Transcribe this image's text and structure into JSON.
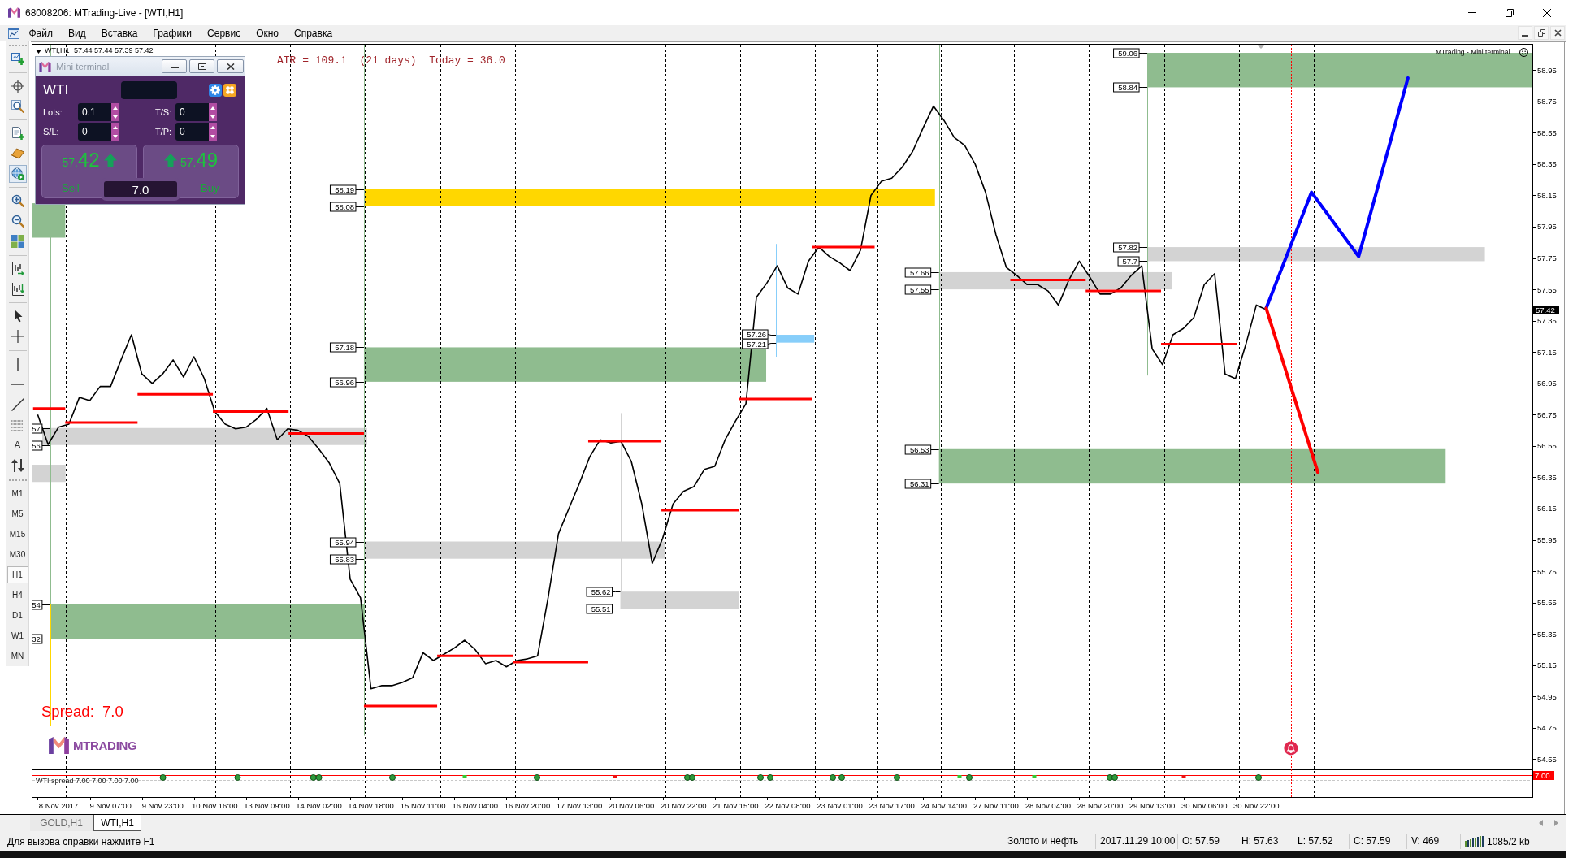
{
  "window": {
    "title": "68008206: MTrading-Live - [WTI,H1]"
  },
  "menu": [
    "Файл",
    "Вид",
    "Вставка",
    "Графики",
    "Сервис",
    "Окно",
    "Справка"
  ],
  "toolbar": {
    "text_tool": "A",
    "timeframes": [
      {
        "label": "M1",
        "selected": false
      },
      {
        "label": "M5",
        "selected": false
      },
      {
        "label": "M15",
        "selected": false
      },
      {
        "label": "M30",
        "selected": false
      },
      {
        "label": "H1",
        "selected": true
      },
      {
        "label": "H4",
        "selected": false
      },
      {
        "label": "D1",
        "selected": false
      },
      {
        "label": "W1",
        "selected": false
      },
      {
        "label": "MN",
        "selected": false
      }
    ]
  },
  "chart": {
    "ohlc": "57.44 57.44 57.39 57.42",
    "atr_text": "ATR = 109.1  (21 days)  Today = 36.0",
    "corner_label": "MTrading - Mini terminal",
    "spread_text": "Spread:  7.0",
    "logo_text": "MTRADING",
    "chart_data": {
      "type": "line",
      "ylim": [
        54.485,
        59.112
      ],
      "categories": [
        null,
        null,
        "8 Nov 2017",
        null,
        null,
        null,
        null,
        "9 Nov 07:00",
        null,
        null,
        null,
        null,
        "9 Nov 23:00",
        null,
        null,
        null,
        null,
        "10 Nov 16:00",
        null,
        null,
        null,
        null,
        "13 Nov 09:00",
        null,
        null,
        null,
        null,
        "14 Nov 02:00",
        null,
        null,
        null,
        null,
        "14 Nov 18:00",
        null,
        null,
        null,
        null,
        "15 Nov 11:00",
        null,
        null,
        null,
        null,
        "16 Nov 04:00",
        null,
        null,
        null,
        null,
        "16 Nov 20:00",
        null,
        null,
        null,
        null,
        "17 Nov 13:00",
        null,
        null,
        null,
        null,
        "20 Nov 06:00",
        null,
        null,
        null,
        null,
        "20 Nov 22:00",
        null,
        null,
        null,
        null,
        "21 Nov 15:00",
        null,
        null,
        null,
        null,
        "22 Nov 08:00",
        null,
        null,
        null,
        null,
        "23 Nov 01:00",
        null,
        null,
        null,
        null,
        "23 Nov 17:00",
        null,
        null,
        null,
        null,
        "24 Nov 14:00",
        null,
        null,
        null,
        null,
        "27 Nov 11:00",
        null,
        null,
        null,
        null,
        "28 Nov 04:00",
        null,
        null,
        null,
        null,
        "28 Nov 20:00",
        null,
        null,
        null,
        null,
        "29 Nov 13:00",
        null,
        null,
        null,
        null,
        "30 Nov 06:00",
        null,
        null,
        null,
        null,
        "30 Nov 22:00",
        null,
        null,
        null,
        null,
        null,
        null,
        null,
        null,
        null,
        null,
        null,
        null,
        null,
        null,
        null,
        null,
        null,
        null,
        null,
        null,
        null,
        null,
        null,
        null,
        null,
        null
      ],
      "series": [
        {
          "name": "WTI,H1",
          "color": "#000000",
          "values": [
            56.75,
            56.56,
            56.67,
            56.69,
            56.86,
            56.84,
            56.93,
            56.93,
            57.1,
            57.26,
            57.01,
            56.95,
            57.01,
            57.1,
            56.99,
            57.12,
            56.98,
            56.77,
            56.69,
            56.66,
            56.67,
            56.72,
            56.79,
            56.59,
            56.66,
            56.65,
            56.61,
            56.53,
            56.44,
            56.31,
            55.7,
            55.58,
            55.0,
            55.02,
            55.02,
            55.04,
            55.07,
            55.23,
            55.18,
            55.22,
            55.26,
            55.31,
            55.25,
            55.16,
            55.18,
            55.14,
            55.18,
            55.19,
            55.21,
            55.58,
            55.99,
            56.15,
            56.31,
            56.48,
            56.59,
            56.57,
            56.58,
            56.45,
            56.18,
            55.8,
            55.96,
            56.18,
            56.26,
            56.29,
            56.4,
            56.42,
            56.59,
            56.71,
            56.82,
            57.5,
            57.59,
            57.7,
            57.56,
            57.52,
            57.73,
            57.82,
            57.76,
            57.72,
            57.67,
            57.8,
            58.15,
            58.24,
            58.26,
            58.33,
            58.43,
            58.58,
            58.72,
            58.63,
            58.52,
            58.47,
            58.35,
            58.17,
            57.9,
            57.69,
            57.64,
            57.58,
            57.58,
            57.54,
            57.45,
            57.61,
            57.73,
            57.63,
            57.52,
            57.52,
            57.56,
            57.64,
            57.7,
            57.17,
            57.07,
            57.26,
            57.3,
            57.37,
            57.58,
            57.65,
            57.01,
            56.98,
            57.2,
            57.45,
            57.42,
            null,
            null,
            null,
            null,
            null,
            null,
            null,
            null,
            null,
            null,
            null,
            null,
            null,
            null,
            null,
            null,
            null,
            null,
            null,
            null,
            null,
            null,
            null,
            null,
            null
          ]
        }
      ],
      "yticks": [
        {
          "value": 58.95,
          "label": "58.95"
        },
        {
          "value": 58.75,
          "label": "58.75"
        },
        {
          "value": 58.55,
          "label": "58.55"
        },
        {
          "value": 58.35,
          "label": "58.35"
        },
        {
          "value": 58.15,
          "label": "58.15"
        },
        {
          "value": 57.95,
          "label": "57.95"
        },
        {
          "value": 57.75,
          "label": "57.75"
        },
        {
          "value": 57.55,
          "label": "57.55"
        },
        {
          "value": 57.35,
          "label": "57.35"
        },
        {
          "value": 57.15,
          "label": "57.15"
        },
        {
          "value": 56.95,
          "label": "56.95"
        },
        {
          "value": 56.75,
          "label": "56.75"
        },
        {
          "value": 56.55,
          "label": "56.55"
        },
        {
          "value": 56.35,
          "label": "56.35"
        },
        {
          "value": 56.15,
          "label": "56.15"
        },
        {
          "value": 55.95,
          "label": "55.95"
        },
        {
          "value": 55.75,
          "label": "55.75"
        },
        {
          "value": 55.55,
          "label": "55.55"
        },
        {
          "value": 55.35,
          "label": "55.35"
        },
        {
          "value": 55.15,
          "label": "55.15"
        },
        {
          "value": 54.95,
          "label": "54.95"
        },
        {
          "value": 54.75,
          "label": "54.75"
        },
        {
          "value": 54.55,
          "label": "54.55"
        }
      ],
      "annotations": [
        "59.06",
        "58.84",
        "58.19",
        "58.08",
        "57.82",
        "57.7",
        "57.66",
        "57.55",
        "57.42",
        "57.26",
        "57.21",
        "57.18",
        "56.96",
        "57",
        "56",
        "56.53",
        "56.31",
        "55.94",
        "55.83",
        "55.62",
        "55.51",
        "54",
        "32"
      ]
    },
    "indicator": {
      "header": "WTI spread 7.00 7.00 7.00 7.00",
      "value_label": "7.00"
    }
  },
  "mini_terminal": {
    "title": "Mini terminal",
    "symbol": "WTI",
    "fields": [
      {
        "label": "Lots:",
        "value": "0.1"
      },
      {
        "label": "T/S:",
        "value": "0"
      },
      {
        "label": "S/L:",
        "value": "0"
      },
      {
        "label": "T/P:",
        "value": "0"
      }
    ],
    "sell": {
      "price_small": "57.",
      "price_large": "42",
      "label": "Sell"
    },
    "buy": {
      "price_small": "57.",
      "price_large": "49",
      "label": "Buy"
    },
    "spread": "7.0"
  },
  "tabs": [
    {
      "label": "GOLD,H1",
      "selected": false
    },
    {
      "label": "WTI,H1",
      "selected": true
    }
  ],
  "status_bar": {
    "help": "Для вызова справки нажмите F1",
    "fields": [
      "Золото и нефть",
      "2017.11.29 10:00",
      "O: 57.59",
      "H: 57.63",
      "L: 57.52",
      "C: 57.59",
      "V: 469"
    ],
    "traffic": "1085/2 kb"
  }
}
